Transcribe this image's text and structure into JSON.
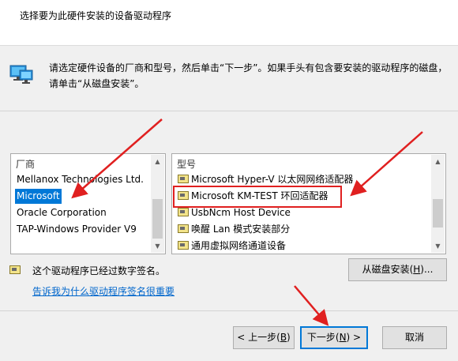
{
  "header": {
    "title": "选择要为此硬件安装的设备驱动程序"
  },
  "info": {
    "text_line1": "请选定硬件设备的厂商和型号，然后单击“下一步”。如果手头有包含要安装的驱动程序的磁盘，",
    "text_line2": "请单击“从磁盘安装”。"
  },
  "manufacturers": {
    "header": "厂商",
    "items": [
      {
        "label": "Mellanox Technologies Ltd."
      },
      {
        "label": "Microsoft"
      },
      {
        "label": "Oracle Corporation"
      },
      {
        "label": "TAP-Windows Provider V9"
      }
    ],
    "selected": "Microsoft"
  },
  "models": {
    "header": "型号",
    "items": [
      {
        "label": "Microsoft Hyper-V 以太网网络适配器"
      },
      {
        "label": "Microsoft KM-TEST 环回适配器"
      },
      {
        "label": "UsbNcm Host Device"
      },
      {
        "label": "唤醒 Lan 模式安装部分"
      },
      {
        "label": "通用虚拟网络通道设备"
      }
    ],
    "highlighted": "Microsoft KM-TEST 环回适配器"
  },
  "signature": {
    "text": "这个驱动程序已经过数字签名。",
    "link": "告诉我为什么驱动程序签名很重要"
  },
  "buttons": {
    "have_disk": "从磁盘安装(",
    "have_disk_key": "H",
    "have_disk_tail": ")...",
    "back": "< 上一步(",
    "back_key": "B",
    "back_tail": ")",
    "next": "下一步(",
    "next_key": "N",
    "next_tail": ") >",
    "cancel": "取消"
  },
  "colors": {
    "selection": "#0078d7",
    "annotation": "#e02020",
    "link": "#0066cc"
  },
  "icons": [
    "network-icon",
    "driver-icon",
    "scroll-up-icon",
    "scroll-down-icon"
  ]
}
